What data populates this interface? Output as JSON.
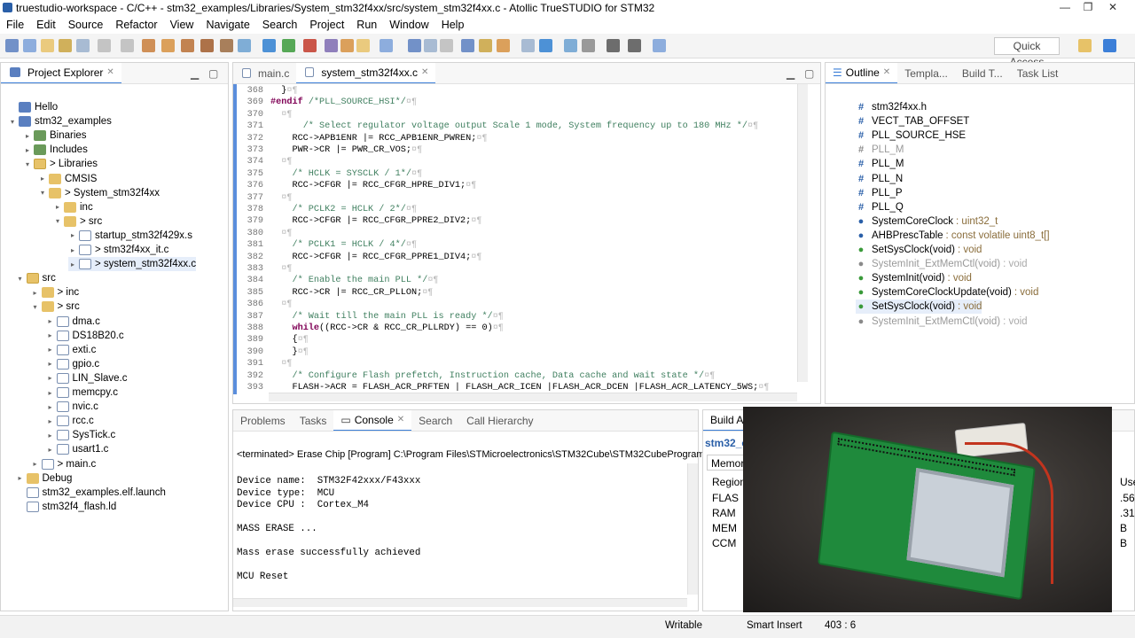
{
  "window": {
    "title": "truestudio-workspace - C/C++ - stm32_examples/Libraries/System_stm32f4xx/src/system_stm32f4xx.c - Atollic TrueSTUDIO for STM32"
  },
  "menu": [
    "File",
    "Edit",
    "Source",
    "Refactor",
    "View",
    "Navigate",
    "Search",
    "Project",
    "Run",
    "Window",
    "Help"
  ],
  "toolbar": {
    "quick_access": "Quick Access"
  },
  "project_explorer": {
    "tab": "Project Explorer",
    "items": [
      {
        "label": "Hello",
        "depth": 0,
        "tw": "",
        "icon": "proj"
      },
      {
        "label": "stm32_examples",
        "depth": 0,
        "tw": "▾",
        "icon": "proj"
      },
      {
        "label": "Binaries",
        "depth": 1,
        "tw": "▸",
        "icon": "lib"
      },
      {
        "label": "Includes",
        "depth": 1,
        "tw": "▸",
        "icon": "lib"
      },
      {
        "label": "> Libraries",
        "depth": 1,
        "tw": "▾",
        "icon": "src"
      },
      {
        "label": "CMSIS",
        "depth": 2,
        "tw": "▸",
        "icon": "fold"
      },
      {
        "label": "> System_stm32f4xx",
        "depth": 2,
        "tw": "▾",
        "icon": "fold"
      },
      {
        "label": "inc",
        "depth": 3,
        "tw": "▸",
        "icon": "fold"
      },
      {
        "label": "> src",
        "depth": 3,
        "tw": "▾",
        "icon": "fold"
      },
      {
        "label": "startup_stm32f429x.s",
        "depth": 4,
        "tw": "▸",
        "icon": "file"
      },
      {
        "label": "> stm32f4xx_it.c",
        "depth": 4,
        "tw": "▸",
        "icon": "file"
      },
      {
        "label": "> system_stm32f4xx.c",
        "depth": 4,
        "tw": "▸",
        "icon": "file"
      },
      {
        "label": "src",
        "depth": 0.5,
        "tw": "▾",
        "icon": "src"
      },
      {
        "label": "> inc",
        "depth": 1.5,
        "tw": "▸",
        "icon": "fold"
      },
      {
        "label": "> src",
        "depth": 1.5,
        "tw": "▾",
        "icon": "fold"
      },
      {
        "label": "dma.c",
        "depth": 2.5,
        "tw": "▸",
        "icon": "file"
      },
      {
        "label": "DS18B20.c",
        "depth": 2.5,
        "tw": "▸",
        "icon": "file"
      },
      {
        "label": "exti.c",
        "depth": 2.5,
        "tw": "▸",
        "icon": "file"
      },
      {
        "label": "gpio.c",
        "depth": 2.5,
        "tw": "▸",
        "icon": "file"
      },
      {
        "label": "LIN_Slave.c",
        "depth": 2.5,
        "tw": "▸",
        "icon": "file"
      },
      {
        "label": "memcpy.c",
        "depth": 2.5,
        "tw": "▸",
        "icon": "file"
      },
      {
        "label": "nvic.c",
        "depth": 2.5,
        "tw": "▸",
        "icon": "file"
      },
      {
        "label": "rcc.c",
        "depth": 2.5,
        "tw": "▸",
        "icon": "file"
      },
      {
        "label": "SysTick.c",
        "depth": 2.5,
        "tw": "▸",
        "icon": "file"
      },
      {
        "label": "usart1.c",
        "depth": 2.5,
        "tw": "▸",
        "icon": "file"
      },
      {
        "label": "> main.c",
        "depth": 1.5,
        "tw": "▸",
        "icon": "file"
      },
      {
        "label": "Debug",
        "depth": 0.5,
        "tw": "▸",
        "icon": "fold"
      },
      {
        "label": "stm32_examples.elf.launch",
        "depth": 0.5,
        "tw": "",
        "icon": "file"
      },
      {
        "label": "stm32f4_flash.ld",
        "depth": 0.5,
        "tw": "",
        "icon": "file"
      }
    ]
  },
  "editor": {
    "tabs": [
      "main.c",
      "system_stm32f4xx.c"
    ],
    "lines": [
      {
        "n": "368",
        "t": "  }¤¶"
      },
      {
        "n": "369",
        "t": "#endif /*PLL_SOURCE_HSI*/¤¶"
      },
      {
        "n": "370",
        "t": "  ¤¶"
      },
      {
        "n": "371",
        "t": "      /* Select regulator voltage output Scale 1 mode, System frequency up to 180 MHz */¤¶"
      },
      {
        "n": "372",
        "t": "    RCC->APB1ENR |= RCC_APB1ENR_PWREN;¤¶"
      },
      {
        "n": "373",
        "t": "    PWR->CR |= PWR_CR_VOS;¤¶"
      },
      {
        "n": "374",
        "t": "  ¤¶"
      },
      {
        "n": "375",
        "t": "    /* HCLK = SYSCLK / 1*/¤¶"
      },
      {
        "n": "376",
        "t": "    RCC->CFGR |= RCC_CFGR_HPRE_DIV1;¤¶"
      },
      {
        "n": "377",
        "t": "  ¤¶"
      },
      {
        "n": "378",
        "t": "    /* PCLK2 = HCLK / 2*/¤¶"
      },
      {
        "n": "379",
        "t": "    RCC->CFGR |= RCC_CFGR_PPRE2_DIV2;¤¶"
      },
      {
        "n": "380",
        "t": "  ¤¶"
      },
      {
        "n": "381",
        "t": "    /* PCLK1 = HCLK / 4*/¤¶"
      },
      {
        "n": "382",
        "t": "    RCC->CFGR |= RCC_CFGR_PPRE1_DIV4;¤¶"
      },
      {
        "n": "383",
        "t": "  ¤¶"
      },
      {
        "n": "384",
        "t": "    /* Enable the main PLL */¤¶"
      },
      {
        "n": "385",
        "t": "    RCC->CR |= RCC_CR_PLLON;¤¶"
      },
      {
        "n": "386",
        "t": "  ¤¶"
      },
      {
        "n": "387",
        "t": "    /* Wait till the main PLL is ready */¤¶"
      },
      {
        "n": "388",
        "t": "    while((RCC->CR & RCC_CR_PLLRDY) == 0)¤¶"
      },
      {
        "n": "389",
        "t": "    {¤¶"
      },
      {
        "n": "390",
        "t": "    }¤¶"
      },
      {
        "n": "391",
        "t": "  ¤¶"
      },
      {
        "n": "392",
        "t": "    /* Configure Flash prefetch, Instruction cache, Data cache and wait state */¤¶"
      },
      {
        "n": "393",
        "t": "    FLASH->ACR = FLASH_ACR_PRFTEN | FLASH_ACR_ICEN |FLASH_ACR_DCEN |FLASH_ACR_LATENCY_5WS;¤¶"
      }
    ]
  },
  "outline": {
    "tabs": [
      "Outline",
      "Templa...",
      "Build T...",
      "Task List"
    ],
    "items": [
      {
        "icon": "#",
        "label": "stm32f4xx.h",
        "type": "",
        "color": "#2a5fa8",
        "muted": false
      },
      {
        "icon": "#",
        "label": "VECT_TAB_OFFSET",
        "type": "",
        "color": "#2a5fa8",
        "muted": false
      },
      {
        "icon": "#",
        "label": "PLL_SOURCE_HSE",
        "type": "",
        "color": "#2a5fa8",
        "muted": false
      },
      {
        "icon": "#",
        "label": "PLL_M",
        "type": "",
        "color": "#8a8a8a",
        "muted": true
      },
      {
        "icon": "#",
        "label": "PLL_M",
        "type": "",
        "color": "#2a5fa8",
        "muted": false
      },
      {
        "icon": "#",
        "label": "PLL_N",
        "type": "",
        "color": "#2a5fa8",
        "muted": false
      },
      {
        "icon": "#",
        "label": "PLL_P",
        "type": "",
        "color": "#2a5fa8",
        "muted": false
      },
      {
        "icon": "#",
        "label": "PLL_Q",
        "type": "",
        "color": "#2a5fa8",
        "muted": false
      },
      {
        "icon": "●",
        "label": "SystemCoreClock",
        "type": ": uint32_t",
        "color": "#2a5fa8",
        "muted": false
      },
      {
        "icon": "●",
        "label": "AHBPrescTable",
        "type": ": const volatile uint8_t[]",
        "color": "#2a5fa8",
        "muted": false
      },
      {
        "icon": "●",
        "label": "SetSysClock(void)",
        "type": ": void",
        "color": "#3a9a3a",
        "muted": false
      },
      {
        "icon": "●",
        "label": "SystemInit_ExtMemCtl(void)",
        "type": ": void",
        "color": "#8a8a8a",
        "muted": true
      },
      {
        "icon": "●",
        "label": "SystemInit(void)",
        "type": ": void",
        "color": "#3a9a3a",
        "muted": false
      },
      {
        "icon": "●",
        "label": "SystemCoreClockUpdate(void)",
        "type": ": void",
        "color": "#3a9a3a",
        "muted": false
      },
      {
        "icon": "●",
        "label": "SetSysClock(void)",
        "type": ": void",
        "color": "#3a9a3a",
        "muted": false
      },
      {
        "icon": "●",
        "label": "SystemInit_ExtMemCtl(void)",
        "type": ": void",
        "color": "#8a8a8a",
        "muted": true
      }
    ]
  },
  "console": {
    "tabs": [
      "Problems",
      "Tasks",
      "Console",
      "Search",
      "Call Hierarchy"
    ],
    "header": "<terminated> Erase Chip [Program] C:\\Program Files\\STMicroelectronics\\STM32Cube\\STM32CubeProgramm",
    "lines": [
      "Device name:  STM32F42xxx/F43xxx",
      "Device type:  MCU",
      "Device CPU :  Cortex_M4",
      "",
      "MASS ERASE ...",
      "",
      "Mass erase successfully achieved",
      "",
      "MCU Reset"
    ]
  },
  "build": {
    "tab": "Build A",
    "title": "stm32_e",
    "subtab": "Memory",
    "col1": "Region",
    "col2": "Used",
    "rows": [
      {
        "name": "FLAS",
        "val": ".56"
      },
      {
        "name": "RAM",
        "val": ".31"
      },
      {
        "name": "MEM",
        "val": "B"
      },
      {
        "name": "CCM",
        "val": "B"
      }
    ]
  },
  "status": {
    "mode": "Writable",
    "insert": "Smart Insert",
    "position": "403 : 6"
  },
  "colors": {
    "accent": "#3c7fd8",
    "comment": "#3f7f5f",
    "keyword": "#7f0055",
    "field": "#0000c0"
  }
}
